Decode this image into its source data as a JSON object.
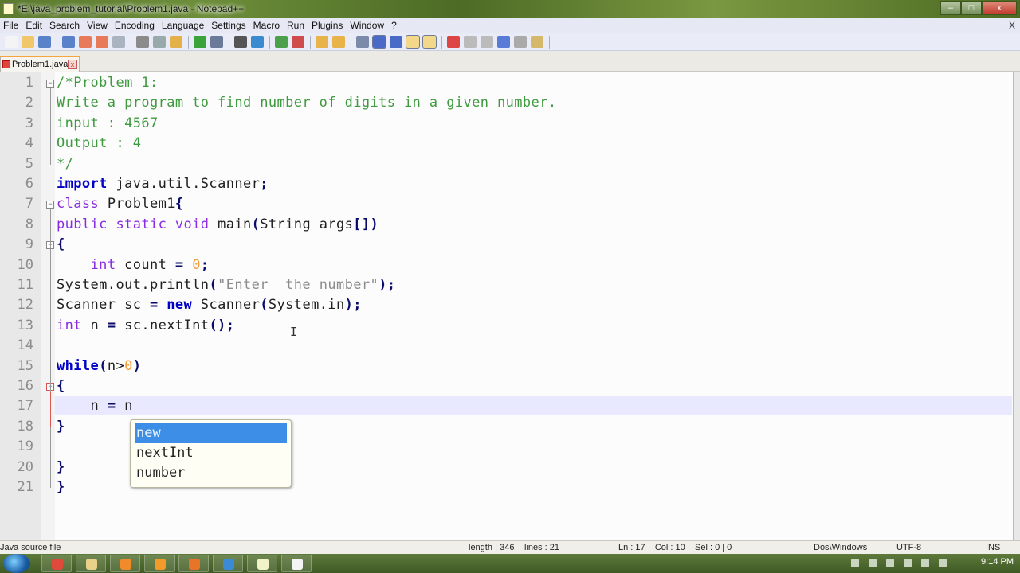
{
  "window": {
    "title": "*E:\\java_problem_tutorial\\Problem1.java - Notepad++",
    "controls": {
      "minimize": "–",
      "maximize": "□",
      "close": "x"
    }
  },
  "menu": {
    "items": [
      "File",
      "Edit",
      "Search",
      "View",
      "Encoding",
      "Language",
      "Settings",
      "Macro",
      "Run",
      "Plugins",
      "Window",
      "?"
    ],
    "close_doc": "X"
  },
  "toolbar": {
    "buttons": [
      "new-file",
      "open-file",
      "save",
      "save-all",
      "close",
      "close-all",
      "print",
      "cut",
      "copy",
      "paste",
      "undo",
      "redo",
      "find",
      "replace",
      "zoom-in",
      "zoom-out",
      "sync-vertical",
      "sync-horizontal",
      "word-wrap",
      "show-all-chars",
      "indent-guide",
      "user-defined-language",
      "doc-map",
      "record-macro",
      "stop-recording",
      "playback",
      "run-macro-multiple",
      "save-macro",
      "spell-check"
    ]
  },
  "tabs": [
    {
      "label": "Problem1.java",
      "close": "x",
      "modified": true
    }
  ],
  "editor": {
    "lines": [
      [
        {
          "t": "/*Problem 1:",
          "c": "cm"
        }
      ],
      [
        {
          "t": "Write a program to find number of digits in a given number.",
          "c": "cm"
        }
      ],
      [
        {
          "t": "input : 4567",
          "c": "cm"
        }
      ],
      [
        {
          "t": "Output : 4",
          "c": "cm"
        }
      ],
      [
        {
          "t": "*/",
          "c": "cm"
        }
      ],
      [
        {
          "t": "import",
          "c": "kw"
        },
        {
          "t": " java.util.Scanner",
          "c": ""
        },
        {
          "t": ";",
          "c": "op"
        }
      ],
      [
        {
          "t": "class",
          "c": "ty"
        },
        {
          "t": " Problem1",
          "c": ""
        },
        {
          "t": "{",
          "c": "op"
        }
      ],
      [
        {
          "t": "public static void",
          "c": "ty"
        },
        {
          "t": " main",
          "c": ""
        },
        {
          "t": "(",
          "c": "op"
        },
        {
          "t": "String args",
          "c": ""
        },
        {
          "t": "[])",
          "c": "op"
        }
      ],
      [
        {
          "t": "{",
          "c": "op"
        }
      ],
      [
        {
          "t": "    ",
          "c": ""
        },
        {
          "t": "int",
          "c": "ty"
        },
        {
          "t": " count ",
          "c": ""
        },
        {
          "t": "=",
          "c": "op"
        },
        {
          "t": " ",
          "c": ""
        },
        {
          "t": "0",
          "c": "num"
        },
        {
          "t": ";",
          "c": "op"
        }
      ],
      [
        {
          "t": "System.out.println",
          "c": ""
        },
        {
          "t": "(",
          "c": "op"
        },
        {
          "t": "\"Enter  the number\"",
          "c": "str"
        },
        {
          "t": ");",
          "c": "op"
        }
      ],
      [
        {
          "t": "Scanner sc ",
          "c": ""
        },
        {
          "t": "=",
          "c": "op"
        },
        {
          "t": " ",
          "c": ""
        },
        {
          "t": "new",
          "c": "kw"
        },
        {
          "t": " Scanner",
          "c": ""
        },
        {
          "t": "(",
          "c": "op"
        },
        {
          "t": "System.in",
          "c": ""
        },
        {
          "t": ");",
          "c": "op"
        }
      ],
      [
        {
          "t": "int",
          "c": "ty"
        },
        {
          "t": " n ",
          "c": ""
        },
        {
          "t": "=",
          "c": "op"
        },
        {
          "t": " sc.nextInt",
          "c": ""
        },
        {
          "t": "();",
          "c": "op"
        }
      ],
      [],
      [
        {
          "t": "while",
          "c": "kw"
        },
        {
          "t": "(",
          "c": "op"
        },
        {
          "t": "n>",
          "c": ""
        },
        {
          "t": "0",
          "c": "num"
        },
        {
          "t": ")",
          "c": "op"
        }
      ],
      [
        {
          "t": "{",
          "c": "op"
        }
      ],
      [
        {
          "t": "    n ",
          "c": ""
        },
        {
          "t": "=",
          "c": "op"
        },
        {
          "t": " n",
          "c": ""
        }
      ],
      [
        {
          "t": "}",
          "c": "op"
        }
      ],
      [],
      [
        {
          "t": "}",
          "c": "op"
        }
      ],
      [
        {
          "t": "}",
          "c": "op"
        }
      ]
    ],
    "current_line": 17
  },
  "autocomplete": {
    "items": [
      "new",
      "nextInt",
      "number"
    ],
    "selected": 0
  },
  "status": {
    "file_type": "Java source file",
    "length": "length : 346",
    "lines": "lines : 21",
    "position": "Ln : 17    Col : 10    Sel : 0 | 0",
    "eol": "Dos\\Windows",
    "encoding": "UTF-8",
    "mode": "INS"
  },
  "taskbar": {
    "apps": [
      "chrome",
      "file-explorer",
      "media-player",
      "vlc",
      "firefox",
      "internet-explorer",
      "notepad-plus-plus",
      "camtasia"
    ],
    "clock": "9:14 PM"
  }
}
